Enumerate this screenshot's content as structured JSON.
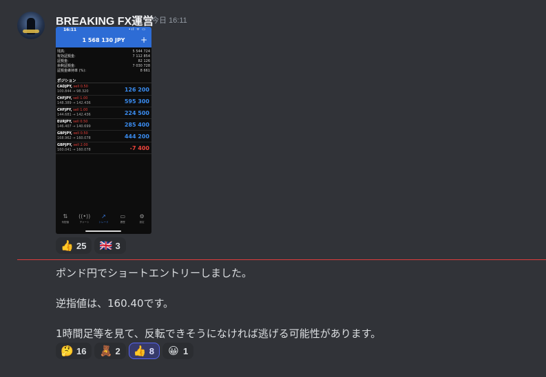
{
  "author": {
    "name": "BREAKING FX運営",
    "timestamp": "今日 16:11"
  },
  "phone": {
    "status_time": "16:11",
    "status_icons": "•ıl ᯤ ▭",
    "balance_header": "1 568 130 JPY",
    "plus_label": "+",
    "account": [
      {
        "label": "残高:",
        "value": "5 544 724"
      },
      {
        "label": "有効証拠金:",
        "value": "7 112 854"
      },
      {
        "label": "証拠金:",
        "value": "82 126"
      },
      {
        "label": "余剰証拠金:",
        "value": "7 030 728"
      },
      {
        "label": "証拠金維持率 (%):",
        "value": "8 661"
      }
    ],
    "positions_header": "ポジション",
    "positions": [
      {
        "symbol": "CADJPY,",
        "side": "sell 0.50",
        "prices": "100.844 → 98.320",
        "pl": "126 200",
        "negative": false
      },
      {
        "symbol": "CHFJPY,",
        "side": "sell 1.00",
        "prices": "148.389 → 142.436",
        "pl": "595 300",
        "negative": false
      },
      {
        "symbol": "CHFJPY,",
        "side": "sell 1.00",
        "prices": "144.681 → 142.436",
        "pl": "224 500",
        "negative": false
      },
      {
        "symbol": "EURJPY,",
        "side": "sell 0.50",
        "prices": "146.407 → 140.699",
        "pl": "285 400",
        "negative": false
      },
      {
        "symbol": "GBPJPY,",
        "side": "sell 0.50",
        "prices": "168.962 → 160.078",
        "pl": "444 200",
        "negative": false
      },
      {
        "symbol": "GBPJPY,",
        "side": "sell 2.00",
        "prices": "160.041 → 160.078",
        "pl": "-7 400",
        "negative": true
      }
    ],
    "tabs": [
      {
        "icon": "⇅",
        "label": "気配値",
        "active": false
      },
      {
        "icon": "((•))",
        "label": "チャート",
        "active": false
      },
      {
        "icon": "↗",
        "label": "トレード",
        "active": true
      },
      {
        "icon": "▭",
        "label": "履歴",
        "active": false
      },
      {
        "icon": "⚙",
        "label": "設定",
        "active": false
      }
    ]
  },
  "reactions_1": [
    {
      "emoji": "👍",
      "count": "25",
      "active": false
    },
    {
      "emoji": "🇬🇧",
      "count": "3",
      "active": false
    }
  ],
  "messages": [
    "ポンド円でショートエントリーしました。",
    "逆指値は、160.40です。",
    "1時間足等を見て、反転できそうになければ逃げる可能性があります。"
  ],
  "reactions_2": [
    {
      "emoji": "🤔",
      "count": "16",
      "active": false
    },
    {
      "emoji": "🧸",
      "count": "2",
      "active": false
    },
    {
      "emoji": "👍",
      "count": "8",
      "active": true
    },
    {
      "emoji": "😀",
      "count": "1",
      "active": false
    }
  ],
  "colors": {
    "background": "#313338",
    "divider": "#e23c3c",
    "accent": "#5865f2",
    "phone_header": "#2d6cd5",
    "profit": "#3a8cf0",
    "loss": "#f0453c"
  }
}
